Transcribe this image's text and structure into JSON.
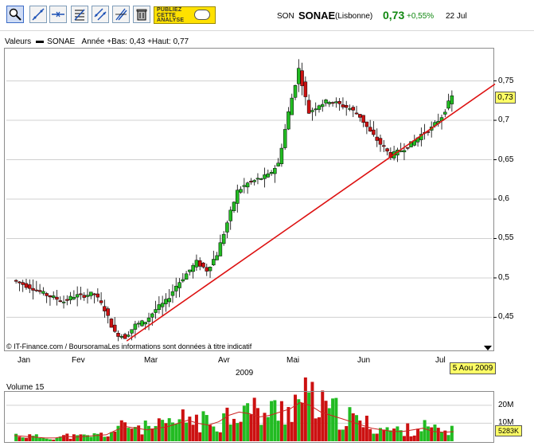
{
  "header": {
    "prefix": "SON",
    "name": "SONAE",
    "market": "(Lisbonne)",
    "price": "0,73",
    "change": "+0,55%",
    "date": "22 Jul"
  },
  "toolbar": {
    "icons": [
      "zoom-icon",
      "trend-line-icon",
      "horizontal-line-icon",
      "fibonacci-icon",
      "channel-icon",
      "parallel-lines-icon",
      "trash-icon"
    ],
    "promo_label": "PUBLIEZ\nCETTE\nANALYSE"
  },
  "info": {
    "label": "Valeurs",
    "series": "SONAE",
    "range": "Année +Bas: 0,43 +Haut: 0,77"
  },
  "credit": "© IT-Finance.com / BoursoramaLes informations sont données à titre indicatif",
  "last_value_tag": "0,73",
  "date_tag": "5 Aou 2009",
  "year_label": "2009",
  "volume": {
    "title": "Volume 15",
    "ticks": [
      "20M",
      "10M"
    ],
    "last_value_tag": "5283K"
  },
  "colors": {
    "up": "#22bb22",
    "down": "#cc1111",
    "trend_line": "#dd1111",
    "volume_ma": "#cc2222"
  },
  "chart_data": {
    "type": "candlestick",
    "title": "",
    "series_name": "SONAE",
    "x_axis": {
      "months": [
        "Jan",
        "Fev",
        "Mar",
        "Avr",
        "Mai",
        "Jun",
        "Jul"
      ],
      "year": "2009"
    },
    "y_axis": {
      "ticks": [
        "0,75",
        "0,7",
        "0,65",
        "0,6",
        "0,55",
        "0,5",
        "0,45"
      ],
      "range": [
        0.41,
        0.79
      ]
    },
    "week_closes": [
      0.497,
      0.492,
      0.487,
      0.48,
      0.475,
      0.47,
      0.477,
      0.478,
      0.48,
      0.46,
      0.43,
      0.425,
      0.44,
      0.445,
      0.46,
      0.47,
      0.49,
      0.505,
      0.52,
      0.51,
      0.53,
      0.57,
      0.61,
      0.62,
      0.625,
      0.63,
      0.645,
      0.71,
      0.765,
      0.71,
      0.72,
      0.725,
      0.72,
      0.715,
      0.705,
      0.685,
      0.67,
      0.655,
      0.662,
      0.67,
      0.682,
      0.69,
      0.705,
      0.73
    ],
    "trend_line": {
      "start_value": 0.42,
      "end_value": 0.74,
      "start_month": "Fev",
      "end_month": "Jul"
    },
    "volume": {
      "unit": "M",
      "ticks": [
        10,
        20
      ],
      "week_values": [
        3.5,
        3,
        2.5,
        2,
        2,
        3,
        2.5,
        3,
        3.5,
        4,
        7,
        9,
        8,
        7,
        8,
        9,
        11,
        13,
        11,
        10,
        12,
        16,
        18,
        17,
        15,
        16,
        18,
        20,
        24,
        22,
        18,
        16,
        14,
        12,
        10,
        8,
        7,
        6,
        6,
        7,
        8,
        6,
        5.5,
        5.3
      ]
    },
    "grid": true
  }
}
